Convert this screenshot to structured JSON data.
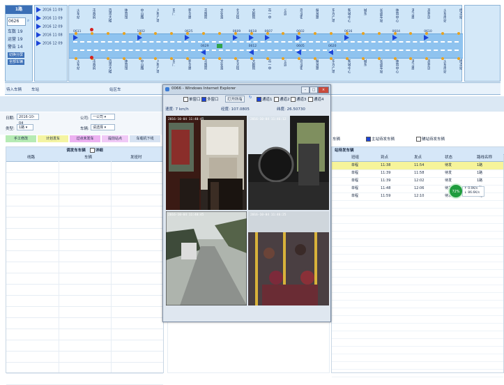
{
  "left_panel": {
    "header": "1路",
    "line_value": "0626",
    "stats": [
      "车数 19",
      "运营 19",
      "警告 14"
    ],
    "buttons": [
      "切换分屏",
      "全部车辆"
    ]
  },
  "times": [
    "2016 11 09",
    "2016 11 09",
    "2016 12 09",
    "2016 11 08",
    "2016 12 09"
  ],
  "route": {
    "top_stations": [
      "火车站",
      "市政府",
      "百货大楼",
      "体育馆",
      "中山路",
      "人民广场",
      "东门",
      "新华路",
      "市医院",
      "文化宫",
      "北大街",
      "大剧院",
      "市一中",
      "公园",
      "商业街",
      "解放路",
      "东方广场",
      "新城中心",
      "城东",
      "长途车站",
      "体育中心",
      "滨江路",
      "高新区",
      "火车南站",
      "终点站"
    ],
    "bottom_stations": [
      "火车站",
      "市政府",
      "百货大楼",
      "体育馆",
      "中山路",
      "人民广场",
      "东门",
      "新华路",
      "市医院",
      "文化宫",
      "北大街",
      "大剧院",
      "市一中",
      "公园",
      "商业街",
      "解放路",
      "东方广场",
      "新城中心",
      "城东",
      "长途车站",
      "体育中心",
      "滨江路",
      "高新区",
      "火车南站",
      "终点站"
    ],
    "bus_labels_top": [
      "0611",
      "1002",
      "0625",
      "0609",
      "0618",
      "0607",
      "0602",
      "0616",
      "0604",
      "0610"
    ],
    "bus_labels_bottom": [
      "0629",
      "0612",
      "0605",
      "0620"
    ]
  },
  "top_bottom": {
    "left_text": "待入车辆",
    "mid_text": "车站",
    "center_text": "站区车"
  },
  "filter": {
    "date_label": "日期:",
    "date_value": "2016-10-04",
    "company_label": "公司:",
    "company_value": "一公司",
    "type_label": "类型:",
    "type_value": "1路",
    "vehicle_label": "车辆:",
    "vehicle_value": "请选择"
  },
  "legend": [
    "手工修改",
    "计划发车",
    "过点未发车",
    "提前站点",
    "车载机下线"
  ],
  "left_table": {
    "title": "调发车车辆",
    "checkbox_label": "详细",
    "columns": [
      "线路",
      "车辆",
      "发班时"
    ]
  },
  "ie": {
    "title": "0066 - Windows Internet Explorer",
    "single_window": "单窗口",
    "multi_window": "多窗口",
    "open_all": "打开所有",
    "channels": [
      "通道1",
      "通道2",
      "通道3",
      "通道4"
    ],
    "speed": "速度: 7 km/h",
    "longitude": "经度: 107.0805",
    "latitude": "纬度: 26.50730",
    "cam_timestamps": [
      "2016-10-04 11:40:45",
      "2016-10-04 11:46:12",
      "2016-10-04 11:40:45",
      "2016-10-04 11:46:25"
    ]
  },
  "right": {
    "filter_left": "车辆",
    "filter_mid": "主站待发车辆",
    "filter_right": "辅站待发车辆",
    "title": "站待发车辆",
    "columns": [
      "班组",
      "到点",
      "发点",
      "状态",
      "路线名称"
    ],
    "rows": [
      [
        "单程",
        "11:38",
        "11:54",
        "待发",
        "1路"
      ],
      [
        "单程",
        "11:39",
        "11:58",
        "待发",
        "1路"
      ],
      [
        "单程",
        "11:39",
        "12:02",
        "待发",
        "1路"
      ],
      [
        "单程",
        "11:48",
        "12:06",
        "待发",
        "1路"
      ],
      [
        "单程",
        "11:59",
        "12:10",
        "待发",
        "1路"
      ]
    ]
  },
  "gauge": {
    "value": "72%",
    "line1": "↑ 0.0K/s",
    "line2": "↓ 86.6K/s"
  }
}
